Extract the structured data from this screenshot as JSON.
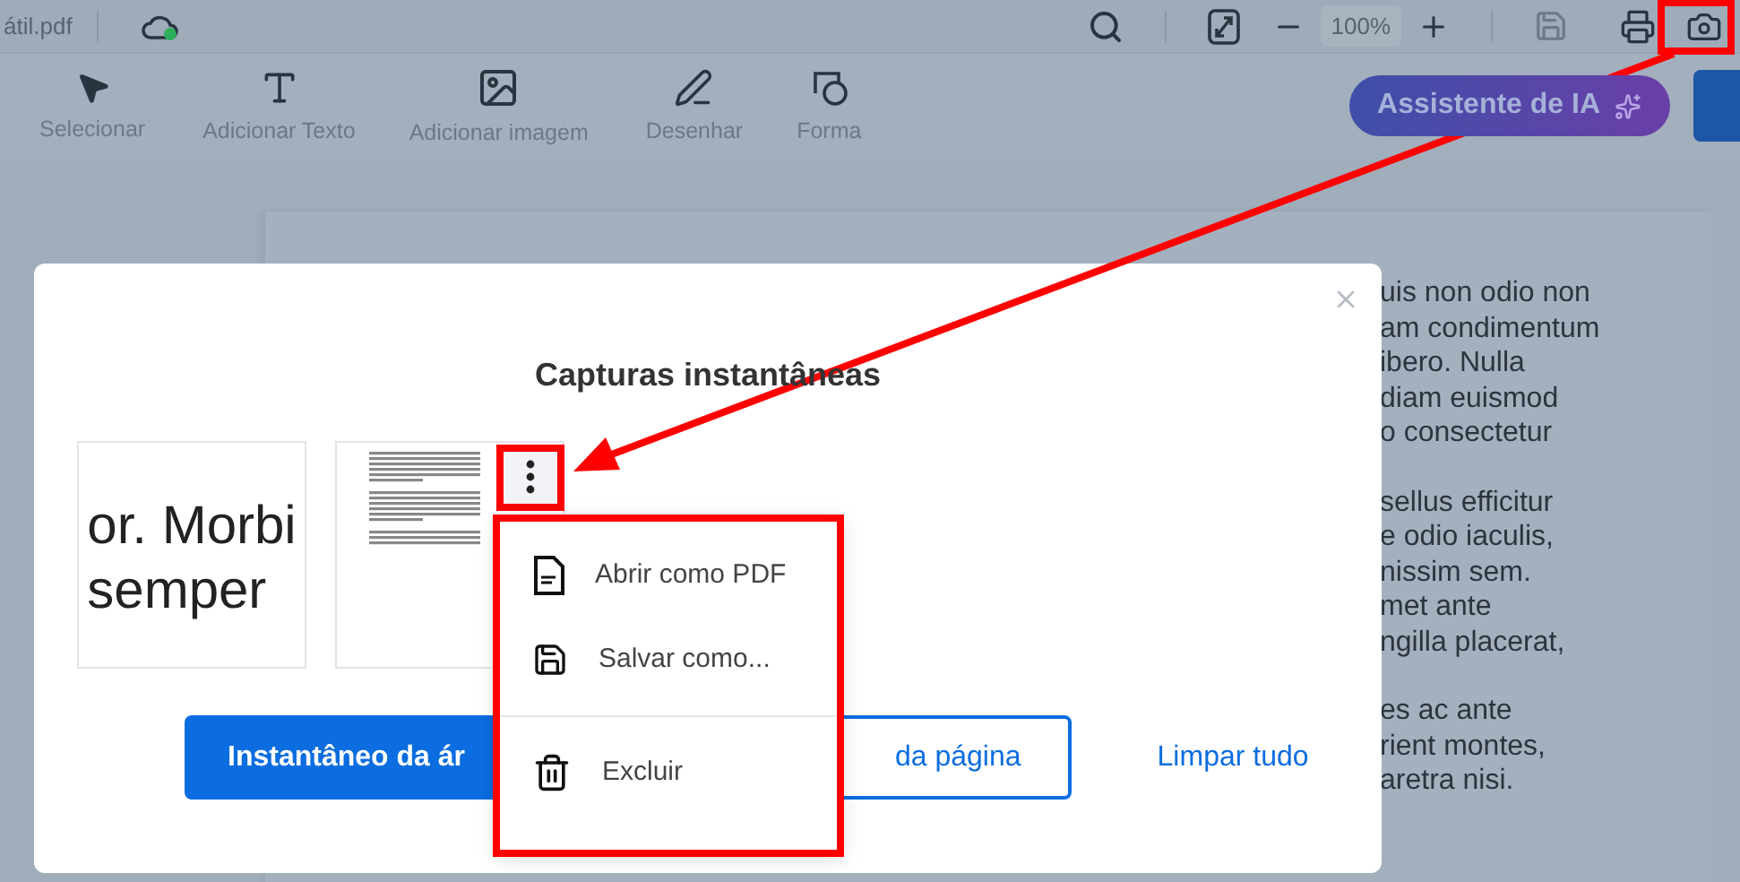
{
  "top_bar": {
    "file_name": "átil.pdf",
    "zoom": "100%"
  },
  "toolbar": {
    "tools": [
      {
        "label": "Selecionar",
        "kind": "pointer"
      },
      {
        "label": "Adicionar Texto",
        "kind": "text"
      },
      {
        "label": "Adicionar imagem",
        "kind": "image"
      },
      {
        "label": "Desenhar",
        "kind": "draw"
      },
      {
        "label": "Forma",
        "kind": "shape"
      }
    ],
    "ai_button": "Assistente de IA"
  },
  "document": {
    "paragraphs": [
      [
        "uis non odio non",
        "am condimentum",
        "ibero. Nulla",
        "diam euismod",
        "o consectetur"
      ],
      [
        "sellus efficitur",
        "e odio iaculis,",
        "nissim sem.",
        "met ante",
        "ngilla placerat,"
      ],
      [
        "es ac ante",
        "rient montes,",
        "aretra nisi."
      ]
    ]
  },
  "dialog": {
    "title": "Capturas instantâneas",
    "snapshots": [
      {
        "kind": "text",
        "lines": [
          "or. Morbi",
          "semper"
        ]
      },
      {
        "kind": "page"
      }
    ],
    "buttons": [
      {
        "label": "Instantâneo da ár",
        "kind": "primary"
      },
      {
        "label": "da página",
        "kind": "outline"
      },
      {
        "label": "Limpar tudo",
        "kind": "link"
      }
    ],
    "menu": {
      "items": [
        {
          "label": "Abrir como PDF",
          "kind": "pdf",
          "separated": false
        },
        {
          "label": "Salvar como...",
          "kind": "save",
          "separated": false
        },
        {
          "label": "Excluir",
          "kind": "delete",
          "separated": true
        }
      ]
    }
  }
}
